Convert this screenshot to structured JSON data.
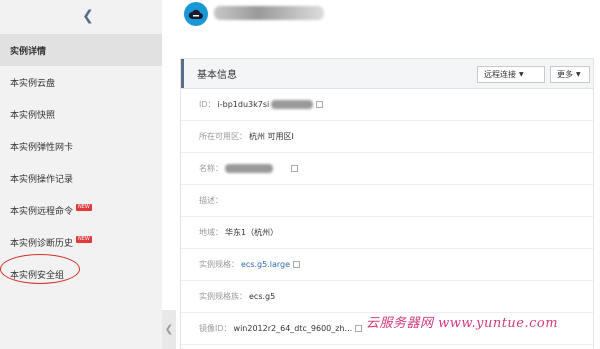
{
  "sidebar": {
    "back_icon": "chevron-left-icon",
    "items": [
      {
        "label": "实例详情",
        "active": true,
        "new": false
      },
      {
        "label": "本实例云盘",
        "active": false,
        "new": false
      },
      {
        "label": "本实例快照",
        "active": false,
        "new": false
      },
      {
        "label": "本实例弹性网卡",
        "active": false,
        "new": false
      },
      {
        "label": "本实例操作记录",
        "active": false,
        "new": false
      },
      {
        "label": "本实例远程命令",
        "active": false,
        "new": true
      },
      {
        "label": "本实例诊断历史",
        "active": false,
        "new": true
      },
      {
        "label": "本实例安全组",
        "active": false,
        "new": false
      }
    ],
    "new_badge": "NEW",
    "collapse_icon": "chevron-left-icon"
  },
  "header": {
    "instance_icon": "cloud-icon",
    "instance_name": "i-bp1du3k7si"
  },
  "panel": {
    "title": "基本信息",
    "remote_button": "远程连接",
    "more_button": "更多",
    "rows": {
      "id_key": "ID：",
      "id_value": "i-bp1du3k7si",
      "zone_key": "所在可用区：",
      "zone_value": "杭州 可用区I",
      "name_key": "名称：",
      "desc_key": "描述：",
      "region_key": "地域：",
      "region_value": "华东1（杭州）",
      "spec_key": "实例规格：",
      "spec_value": "ecs.g5.large",
      "family_key": "实例规格族：",
      "family_value": "ecs.g5",
      "image_key": "镜像ID：",
      "image_value": "win2012r2_64_dtc_9600_zh..."
    }
  },
  "watermark": "云服务器网 www.yuntue.com",
  "colors": {
    "accent": "#1a97d6",
    "link": "#2b6cb0",
    "annotation": "#d2332c",
    "watermark": "#d4397f"
  }
}
